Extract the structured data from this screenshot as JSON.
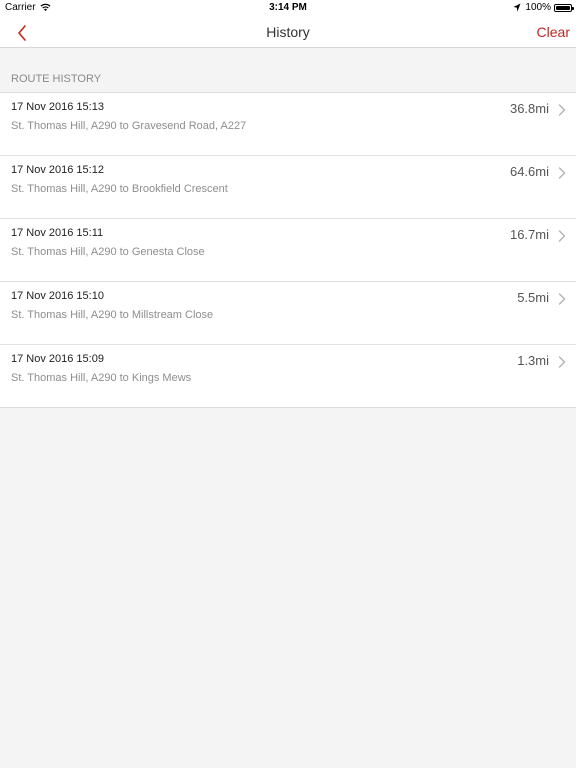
{
  "status_bar": {
    "carrier": "Carrier",
    "time": "3:14 PM",
    "battery_text": "100%"
  },
  "nav": {
    "title": "History",
    "clear_label": "Clear",
    "accent_color": "#c0281f"
  },
  "section": {
    "header": "ROUTE HISTORY"
  },
  "routes": [
    {
      "date": "17 Nov 2016 15:13",
      "route": "St. Thomas Hill, A290 to Gravesend Road, A227",
      "distance": "36.8mi"
    },
    {
      "date": "17 Nov 2016 15:12",
      "route": "St. Thomas Hill, A290 to Brookfield Crescent",
      "distance": "64.6mi"
    },
    {
      "date": "17 Nov 2016 15:11",
      "route": "St. Thomas Hill, A290 to Genesta Close",
      "distance": "16.7mi"
    },
    {
      "date": "17 Nov 2016 15:10",
      "route": "St. Thomas Hill, A290 to Millstream Close",
      "distance": "5.5mi"
    },
    {
      "date": "17 Nov 2016 15:09",
      "route": "St. Thomas Hill, A290 to Kings Mews",
      "distance": "1.3mi"
    }
  ]
}
